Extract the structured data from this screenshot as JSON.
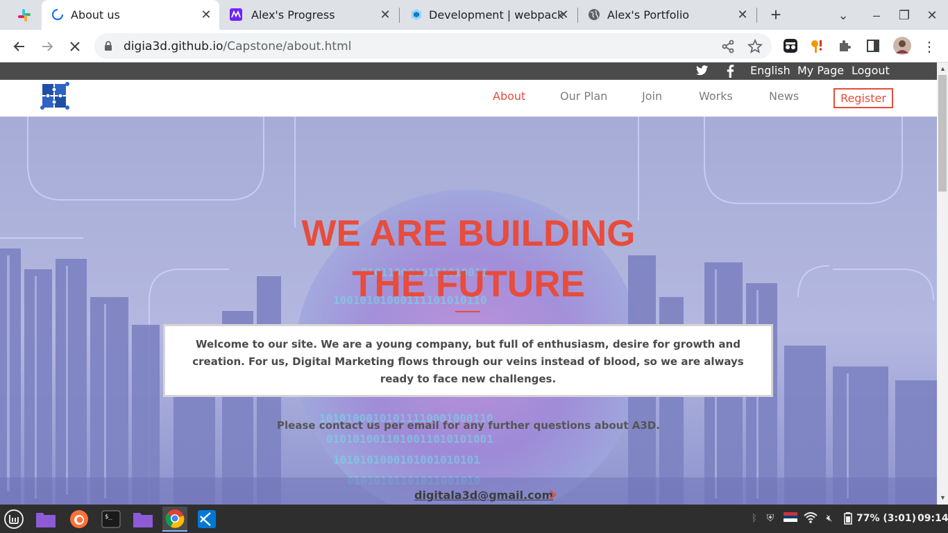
{
  "browser": {
    "tabs": [
      {
        "title": "About us",
        "icon": "loading-spinner-icon",
        "active": true
      },
      {
        "title": "Alex's Progress",
        "icon": "microverse-icon",
        "active": false
      },
      {
        "title": "Development | webpack",
        "icon": "webpack-icon",
        "active": false
      },
      {
        "title": "Alex's Portfolio",
        "icon": "globe-icon",
        "active": false
      }
    ],
    "url_host": "digia3d.github.io",
    "url_path": "/Capstone/about.html"
  },
  "site": {
    "topbar": {
      "links": [
        "English",
        "My Page",
        "Logout"
      ],
      "social_icons": [
        "twitter-icon",
        "facebook-icon"
      ]
    },
    "logo_icon": "a3d-puzzle-logo",
    "nav": {
      "items": [
        "About",
        "Our Plan",
        "Join",
        "Works",
        "News"
      ],
      "active_item": "About",
      "register": "Register"
    },
    "hero": {
      "headline_line1": "WE ARE BUILDING",
      "headline_line2": "THE FUTURE",
      "welcome": "Welcome to our site. We are a young company, but full of enthusiasm, desire for growth and creation. For us, Digital Marketing flows through our veins instead of blood, so we are always ready to face new challenges.",
      "contact": "Please contact us per email for any further questions about A3D.",
      "email": "digitala3d@gmail.com"
    },
    "colors": {
      "accent": "#e74c3c",
      "topbar": "#4b4b4b"
    }
  },
  "taskbar": {
    "battery": "77% (3:01)",
    "clock": "09:14"
  }
}
